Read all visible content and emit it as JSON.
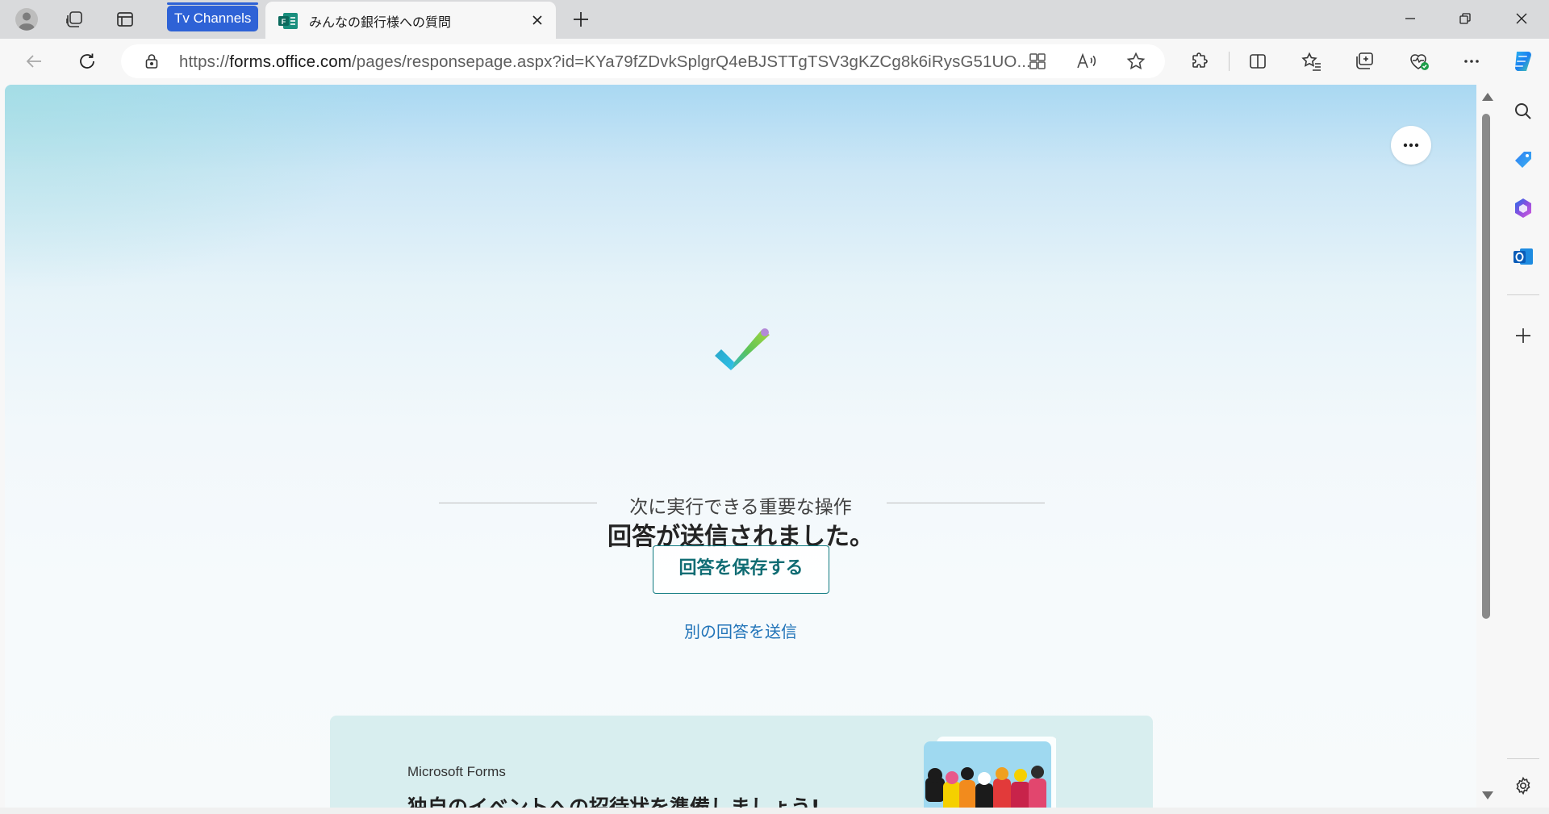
{
  "browser": {
    "tab_group_label": "Tv Channels",
    "active_tab_title": "みんなの銀行様への質問",
    "url_prefix": "https://",
    "url_host": "forms.office.com",
    "url_path": "/pages/responsepage.aspx?id=KYa79fZDvkSplgrQ4eBJSTTgTSV3gKZCg8k6iRysG51UO...",
    "icons": {
      "profile": "profile-icon",
      "workspaces": "workspaces-icon",
      "tab_actions": "vertical-tabs-icon",
      "back": "back-arrow-icon",
      "refresh": "refresh-icon",
      "lock": "lock-icon",
      "read_aloud": "read-aloud-icon",
      "favorite": "star-icon"
    }
  },
  "page": {
    "confirmation_title": "回答が送信されました。",
    "actions_heading": "次に実行できる重要な操作",
    "save_button_label": "回答を保存する",
    "submit_another_label": "別の回答を送信",
    "promo_brand": "Microsoft Forms",
    "promo_title": "独自のイベントへの招待状を準備しましょう!"
  },
  "colors": {
    "accent_teal": "#0f6c73",
    "link_blue": "#2073b8",
    "tab_group_blue": "#2e62d6"
  }
}
